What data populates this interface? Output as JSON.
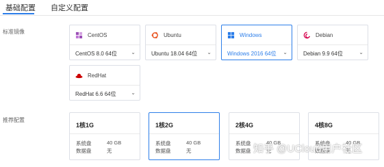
{
  "tabs": [
    {
      "label": "基础配置",
      "active": true
    },
    {
      "label": "自定义配置",
      "active": false
    }
  ],
  "image_section": {
    "label": "标准镜像",
    "os_options": [
      {
        "name": "CentOS",
        "version": "CentOS 8.0 64位",
        "icon": "centos-icon",
        "selected": false
      },
      {
        "name": "Ubuntu",
        "version": "Ubuntu 18.04 64位",
        "icon": "ubuntu-icon",
        "selected": false
      },
      {
        "name": "Windows",
        "version": "Windows 2016 64位",
        "icon": "windows-icon",
        "selected": true
      },
      {
        "name": "Debian",
        "version": "Debian 9.9 64位",
        "icon": "debian-icon",
        "selected": false
      },
      {
        "name": "RedHat",
        "version": "RedHat 6.6 64位",
        "icon": "redhat-icon",
        "selected": false
      }
    ]
  },
  "spec_section": {
    "label": "推荐配置",
    "specs": [
      {
        "title": "1核1G",
        "sys_label": "系统盘",
        "sys_value": "40 GB",
        "data_label": "数据盘",
        "data_value": "无",
        "selected": false
      },
      {
        "title": "1核2G",
        "sys_label": "系统盘",
        "sys_value": "40 GB",
        "data_label": "数据盘",
        "data_value": "无",
        "selected": true
      },
      {
        "title": "2核4G",
        "sys_label": "系统盘",
        "sys_value": "40 GB",
        "data_label": "数据盘",
        "data_value": "无",
        "selected": false
      },
      {
        "title": "4核8G",
        "sys_label": "系统盘",
        "sys_value": "40 GB",
        "data_label": "数据盘",
        "data_value": "无",
        "selected": false
      }
    ]
  },
  "watermark": "知乎 @UCloud用户社区",
  "colors": {
    "accent": "#2b7de9",
    "border": "#dcdfe6",
    "centos": "#9b4fb5",
    "ubuntu": "#e95420",
    "windows": "#2b7de9",
    "debian": "#d70751",
    "redhat": "#cc0000"
  }
}
